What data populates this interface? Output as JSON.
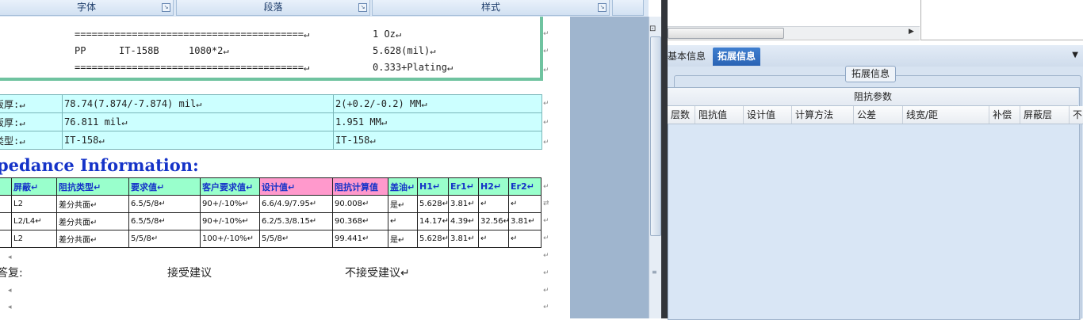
{
  "ribbon": {
    "groups": [
      "字体",
      "段落",
      "样式"
    ],
    "launcher_icon": "dialog-launcher-icon"
  },
  "stackup": {
    "row1": {
      "left": "========================================↵",
      "right": "1 Oz↵"
    },
    "row2": {
      "c1": "PP",
      "c2": "IT-158B",
      "c3": "1080*2↵",
      "right": "5.628(mil)↵"
    },
    "row3": {
      "left": "========================================↵",
      "right": "0.333+Plating↵"
    }
  },
  "thickness": [
    [
      "板厚:↵",
      "78.74(7.874/-7.874) mil↵",
      "2(+0.2/-0.2) MM↵"
    ],
    [
      "板厚:↵",
      "76.811 mil↵",
      "1.951 MM↵"
    ],
    [
      "类型:↵",
      "IT-158↵",
      "IT-158↵"
    ]
  ],
  "heading": "pedance Information:",
  "impedance": {
    "headers": [
      "",
      "屏蔽↵",
      "阻抗类型↵",
      "要求值↵",
      "客户要求值↵",
      "设计值↵",
      "阻抗计算值",
      "盖油↵",
      "H1↵",
      "Er1↵",
      "H2↵",
      "Er2↵"
    ],
    "rows": [
      [
        "",
        "L2",
        "差分共面↵",
        "6.5/5/8↵",
        "90+/-10%↵",
        "6.6/4.9/7.95↵",
        "90.008↵",
        "是↵",
        "5.628↵",
        "3.81↵",
        "↵",
        "↵"
      ],
      [
        "",
        "L2/L4↵",
        "差分共面↵",
        "6.5/5/8↵",
        "90+/-10%↵",
        "6.2/5.3/8.15↵",
        "90.368↵",
        "↵",
        "14.17↵",
        "4.39↵",
        "32.56↵",
        "3.81↵"
      ],
      [
        "",
        "L2",
        "差分共面↵",
        "5/5/8↵",
        "100+/-10%↵",
        "5/5/8↵",
        "99.441↵",
        "是↵",
        "5.628↵",
        "3.81↵",
        "↵",
        "↵"
      ]
    ]
  },
  "reply": {
    "label": "答复:",
    "accept": "接受建议",
    "reject": "不接受建议↵"
  },
  "right_panel": {
    "tabs": [
      "基本信息",
      "拓展信息"
    ],
    "active_tab": "拓展信息",
    "group_title": "拓展信息",
    "grid_title": "阻抗参数",
    "columns": [
      "层数",
      "阻抗值",
      "设计值",
      "计算方法",
      "公差",
      "线宽/距",
      "补偿",
      "屏蔽层",
      "不"
    ]
  },
  "colors": {
    "table_cyan": "#ccffff",
    "header_green": "#99ffcc",
    "header_pink": "#ff99cc",
    "heading_blue": "#1533c8",
    "tab_active": "#2a63b4"
  }
}
